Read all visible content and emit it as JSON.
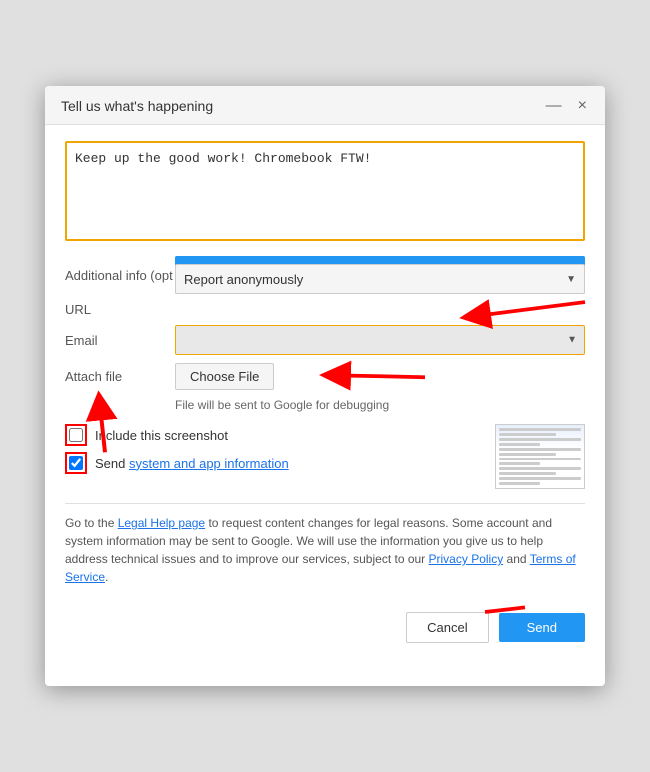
{
  "dialog": {
    "title": "Tell us what's happening",
    "minimize_label": "—",
    "close_label": "×",
    "feedback_placeholder": "Keep up the good work! Chromebook FTW!",
    "feedback_value": "Keep up the good work! Chromebook FTW!",
    "additional_info_label": "Additional info (opt",
    "url_label": "URL",
    "email_label": "Email",
    "attach_label": "Attach file",
    "choose_file_label": "Choose File",
    "file_hint": "File will be sent to Google for debugging",
    "report_anonymous_text": "Report anonymously",
    "include_screenshot_label": "Include this screenshot",
    "send_system_label": "Send",
    "system_link_text": "system and app information",
    "legal_text": "Go to the ",
    "legal_link1": "Legal Help page",
    "legal_middle": " to request content changes for legal reasons. Some account and system information may be sent to Google. We will use the information you give us to help address technical issues and to improve our services, subject to our ",
    "legal_link2": "Privacy Policy",
    "legal_and": " and ",
    "legal_link3": "Terms of Service",
    "legal_end": ".",
    "cancel_label": "Cancel",
    "send_button_label": "Send",
    "colors": {
      "accent_blue": "#2196F3",
      "border_orange": "#f0a500",
      "link_blue": "#1a73e8"
    }
  }
}
